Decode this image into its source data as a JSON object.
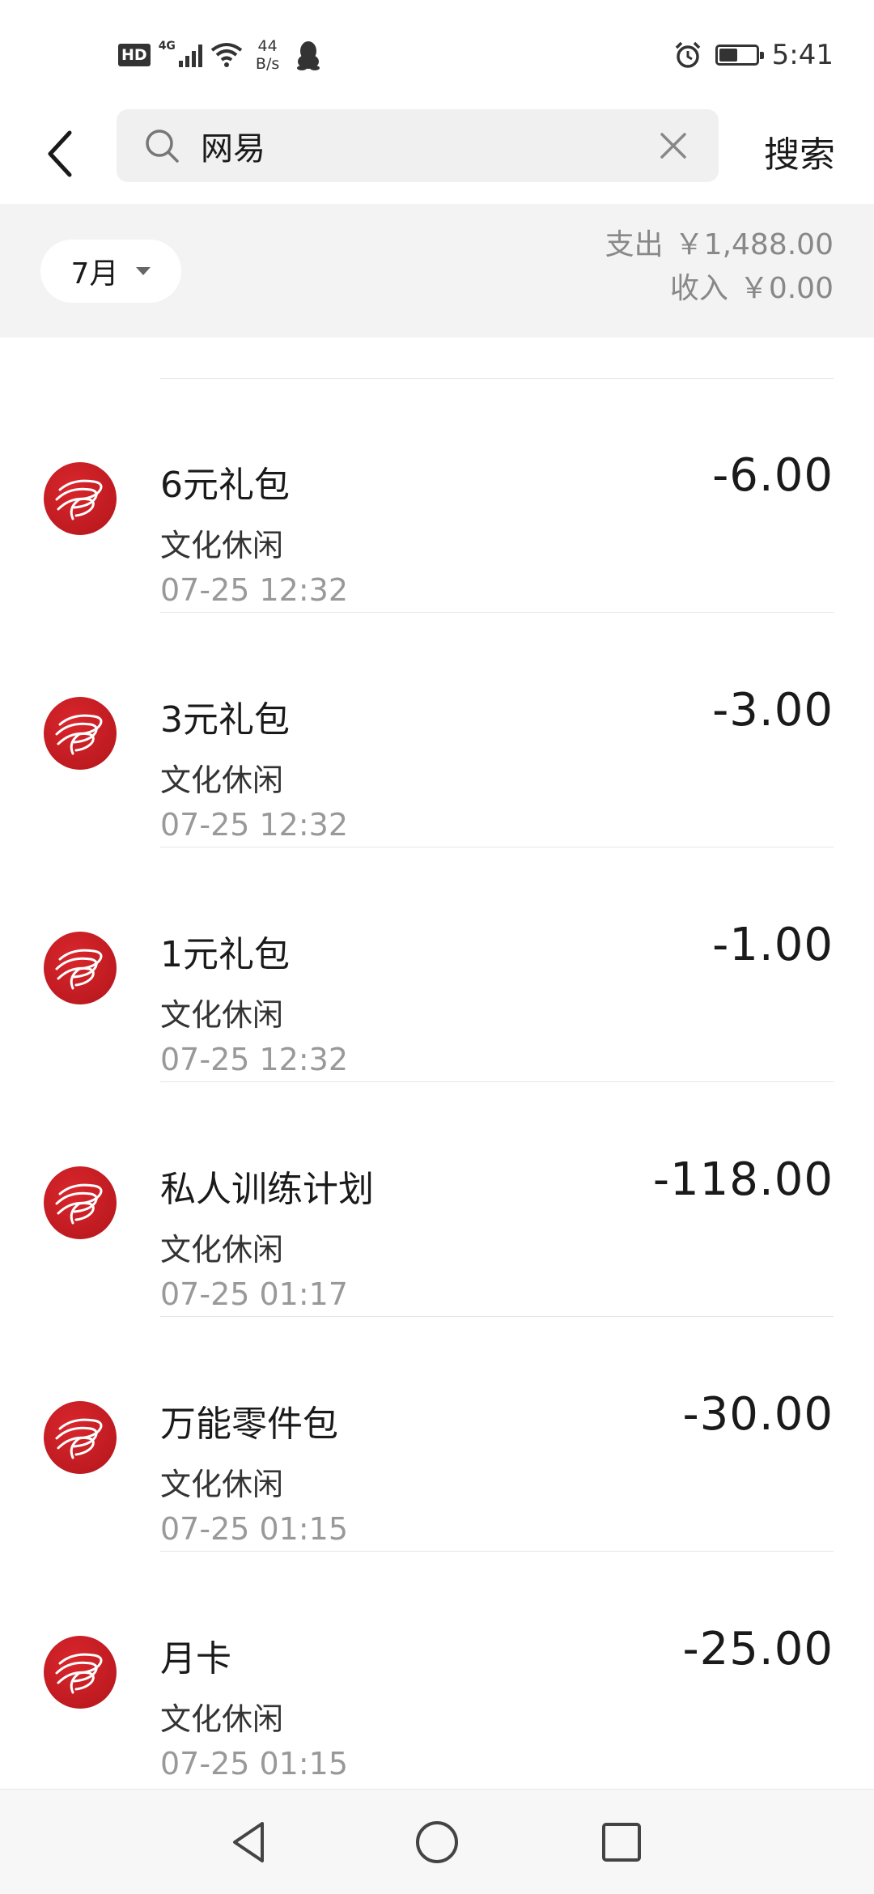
{
  "status_bar": {
    "hd": "HD",
    "network": "4G",
    "speed_value": "44",
    "speed_unit": "B/s",
    "time": "5:41",
    "battery_level": 0.5
  },
  "search": {
    "query": "网易",
    "placeholder": "",
    "search_label": "搜索"
  },
  "summary": {
    "month": "7月",
    "expense_label": "支出",
    "expense_value": "￥1,488.00",
    "income_label": "收入",
    "income_value": "￥0.00"
  },
  "transactions": [
    {
      "title": "6元礼包",
      "category": "文化休闲",
      "time": "07-25  12:32",
      "amount": "-6.00"
    },
    {
      "title": "3元礼包",
      "category": "文化休闲",
      "time": "07-25  12:32",
      "amount": "-3.00"
    },
    {
      "title": "1元礼包",
      "category": "文化休闲",
      "time": "07-25  12:32",
      "amount": "-1.00"
    },
    {
      "title": "私人训练计划",
      "category": "文化休闲",
      "time": "07-25  01:17",
      "amount": "-118.00"
    },
    {
      "title": "万能零件包",
      "category": "文化休闲",
      "time": "07-25  01:15",
      "amount": "-30.00"
    },
    {
      "title": "月卡",
      "category": "文化休闲",
      "time": "07-25  01:15",
      "amount": "-25.00"
    }
  ],
  "icons": {
    "back": "chevron-left-icon",
    "search": "search-icon",
    "clear": "close-icon",
    "merchant_logo": "netease-logo-icon",
    "nav_back": "triangle-back-icon",
    "nav_home": "circle-home-icon",
    "nav_recent": "square-recent-icon"
  },
  "colors": {
    "logo_red": "#c8191f",
    "summary_bg": "#f3f3f3",
    "search_bg": "#f0f0f0"
  }
}
